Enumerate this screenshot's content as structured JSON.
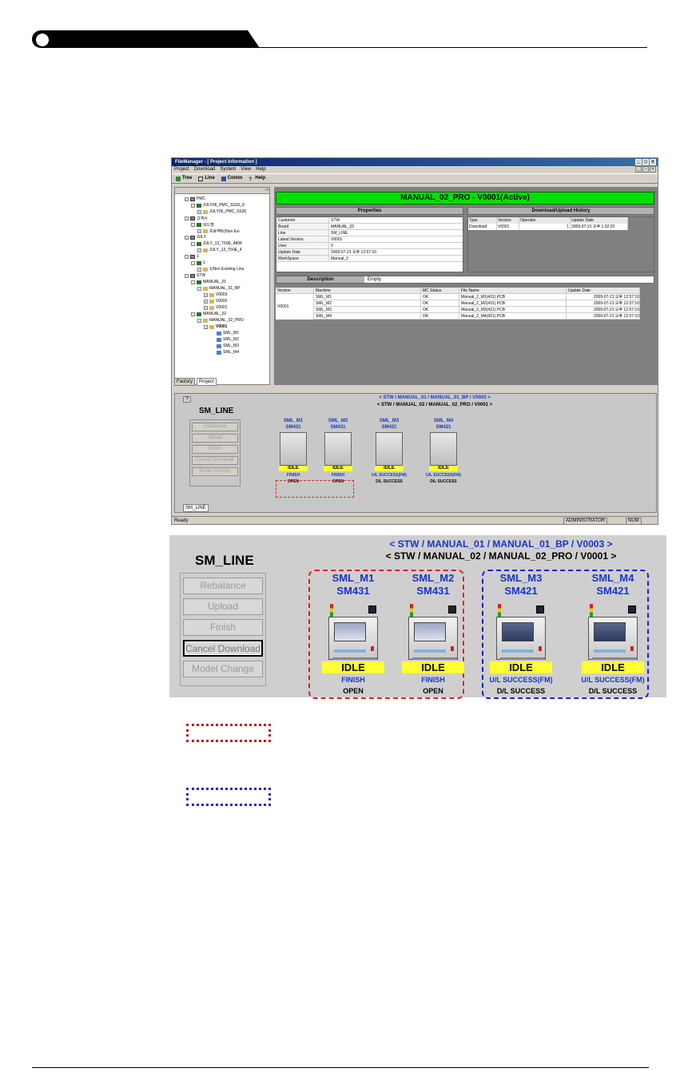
{
  "window": {
    "title": "FileManager - [ Project Information ]",
    "menu": [
      "Project",
      "Download",
      "System",
      "View",
      "Help"
    ],
    "toolbar": [
      "Tree",
      "Line",
      "Comm",
      "Help"
    ],
    "active_title": "MANUAL_02_PRO  -  V0001(Active)",
    "properties_header": "Properties",
    "history_header": "Download/Upload History",
    "properties": [
      {
        "k": "Customer",
        "v": "STW"
      },
      {
        "k": "Board",
        "v": "MANUAL_02"
      },
      {
        "k": "Line",
        "v": "SM_LINE"
      },
      {
        "k": "Latest Version",
        "v": "V0001"
      },
      {
        "k": "User",
        "v": "0"
      },
      {
        "k": "Update Date",
        "v": "2009-07-21 오후 12:57:10"
      },
      {
        "k": "WorkSpace",
        "v": "Manual_2"
      }
    ],
    "history_cols": [
      "Type",
      "Version",
      "Operator",
      "Update Date"
    ],
    "history_row": [
      "Download",
      "V0001",
      "1",
      "2009-07-21 오후 1:32:20"
    ],
    "description_label": "Description",
    "description_value": "Empty",
    "version_cols": [
      "Version",
      "Machine",
      "MC Status",
      "File Name",
      "Update Date"
    ],
    "version_label": "V0001",
    "version_rows": [
      [
        "SML_M1",
        "OK",
        "Manual_2_M1(431).PCB",
        "2009-07-21 오후 12:57:10"
      ],
      [
        "SML_M2",
        "OK",
        "Manual_2_M2(431).PCB",
        "2009-07-21 오후 12:57:10"
      ],
      [
        "SML_M3",
        "OK",
        "Manual_2_M3(421).PCB",
        "2009-07-21 오후 12:57:10"
      ],
      [
        "SML_M4",
        "OK",
        "Manual_2_M4(421).PCB",
        "2009-07-21 오후 12:57:10"
      ]
    ],
    "tree": [
      "PMC",
      "JULY06_PMC_SS30_8",
      "JULY06_PMC_SS30",
      "고객사",
      "보드명",
      "프로젝트(Non Exi",
      "JULY",
      "JULY_13_T50E_4808",
      "JULY_13_T50E_4",
      "1",
      "1",
      "1(Non Existing Linu",
      "STW",
      "MANUAL_01",
      "MANUAL_01_BP",
      "V0003",
      "V0002",
      "V0001",
      "MANUAL_02",
      "MANUAL_02_PRO",
      "V0001",
      "SML_M1",
      "SML_M2",
      "SML_M3",
      "SML_M4"
    ],
    "tree_tabs": [
      "Factory",
      "Project"
    ],
    "line_tab": "SM_LINE",
    "status_left": "Ready",
    "status_user": "ADMINISTRATOR",
    "status_num": "NUM"
  },
  "line": {
    "title": "SM_LINE",
    "path1": "< STW / MANUAL_01 / MANUAL_01_BP / V0003 >",
    "path2": "< STW / MANUAL_02 / MANUAL_02_PRO / V0001 >",
    "buttons": [
      "Rebalance",
      "Upload",
      "Finish",
      "Cancel Download",
      "Model Change"
    ],
    "machines": [
      {
        "name": "SML_M1",
        "model": "SM431",
        "state": "IDLE",
        "status1": "FINISH",
        "status2": "OPEN"
      },
      {
        "name": "SML_M2",
        "model": "SM431",
        "state": "IDLE",
        "status1": "FINISH",
        "status2": "OPEN"
      },
      {
        "name": "SML_M3",
        "model": "SM421",
        "state": "IDLE",
        "status1": "U/L SUCCESS(FM)",
        "status2": "D/L SUCCESS"
      },
      {
        "name": "SML_M4",
        "model": "SM421",
        "state": "IDLE",
        "status1": "U/L SUCCESS(FM)",
        "status2": "D/L SUCCESS"
      }
    ],
    "small_path2": "< STW / MANUAL_02 / MANUAL_02_PRO / V0001 >"
  },
  "colors": {
    "active_green": "#00e000",
    "path_blue": "#1a34c8",
    "idle_yellow": "#ffff33",
    "group_red": "#e02020",
    "group_blue": "#2020d0"
  }
}
